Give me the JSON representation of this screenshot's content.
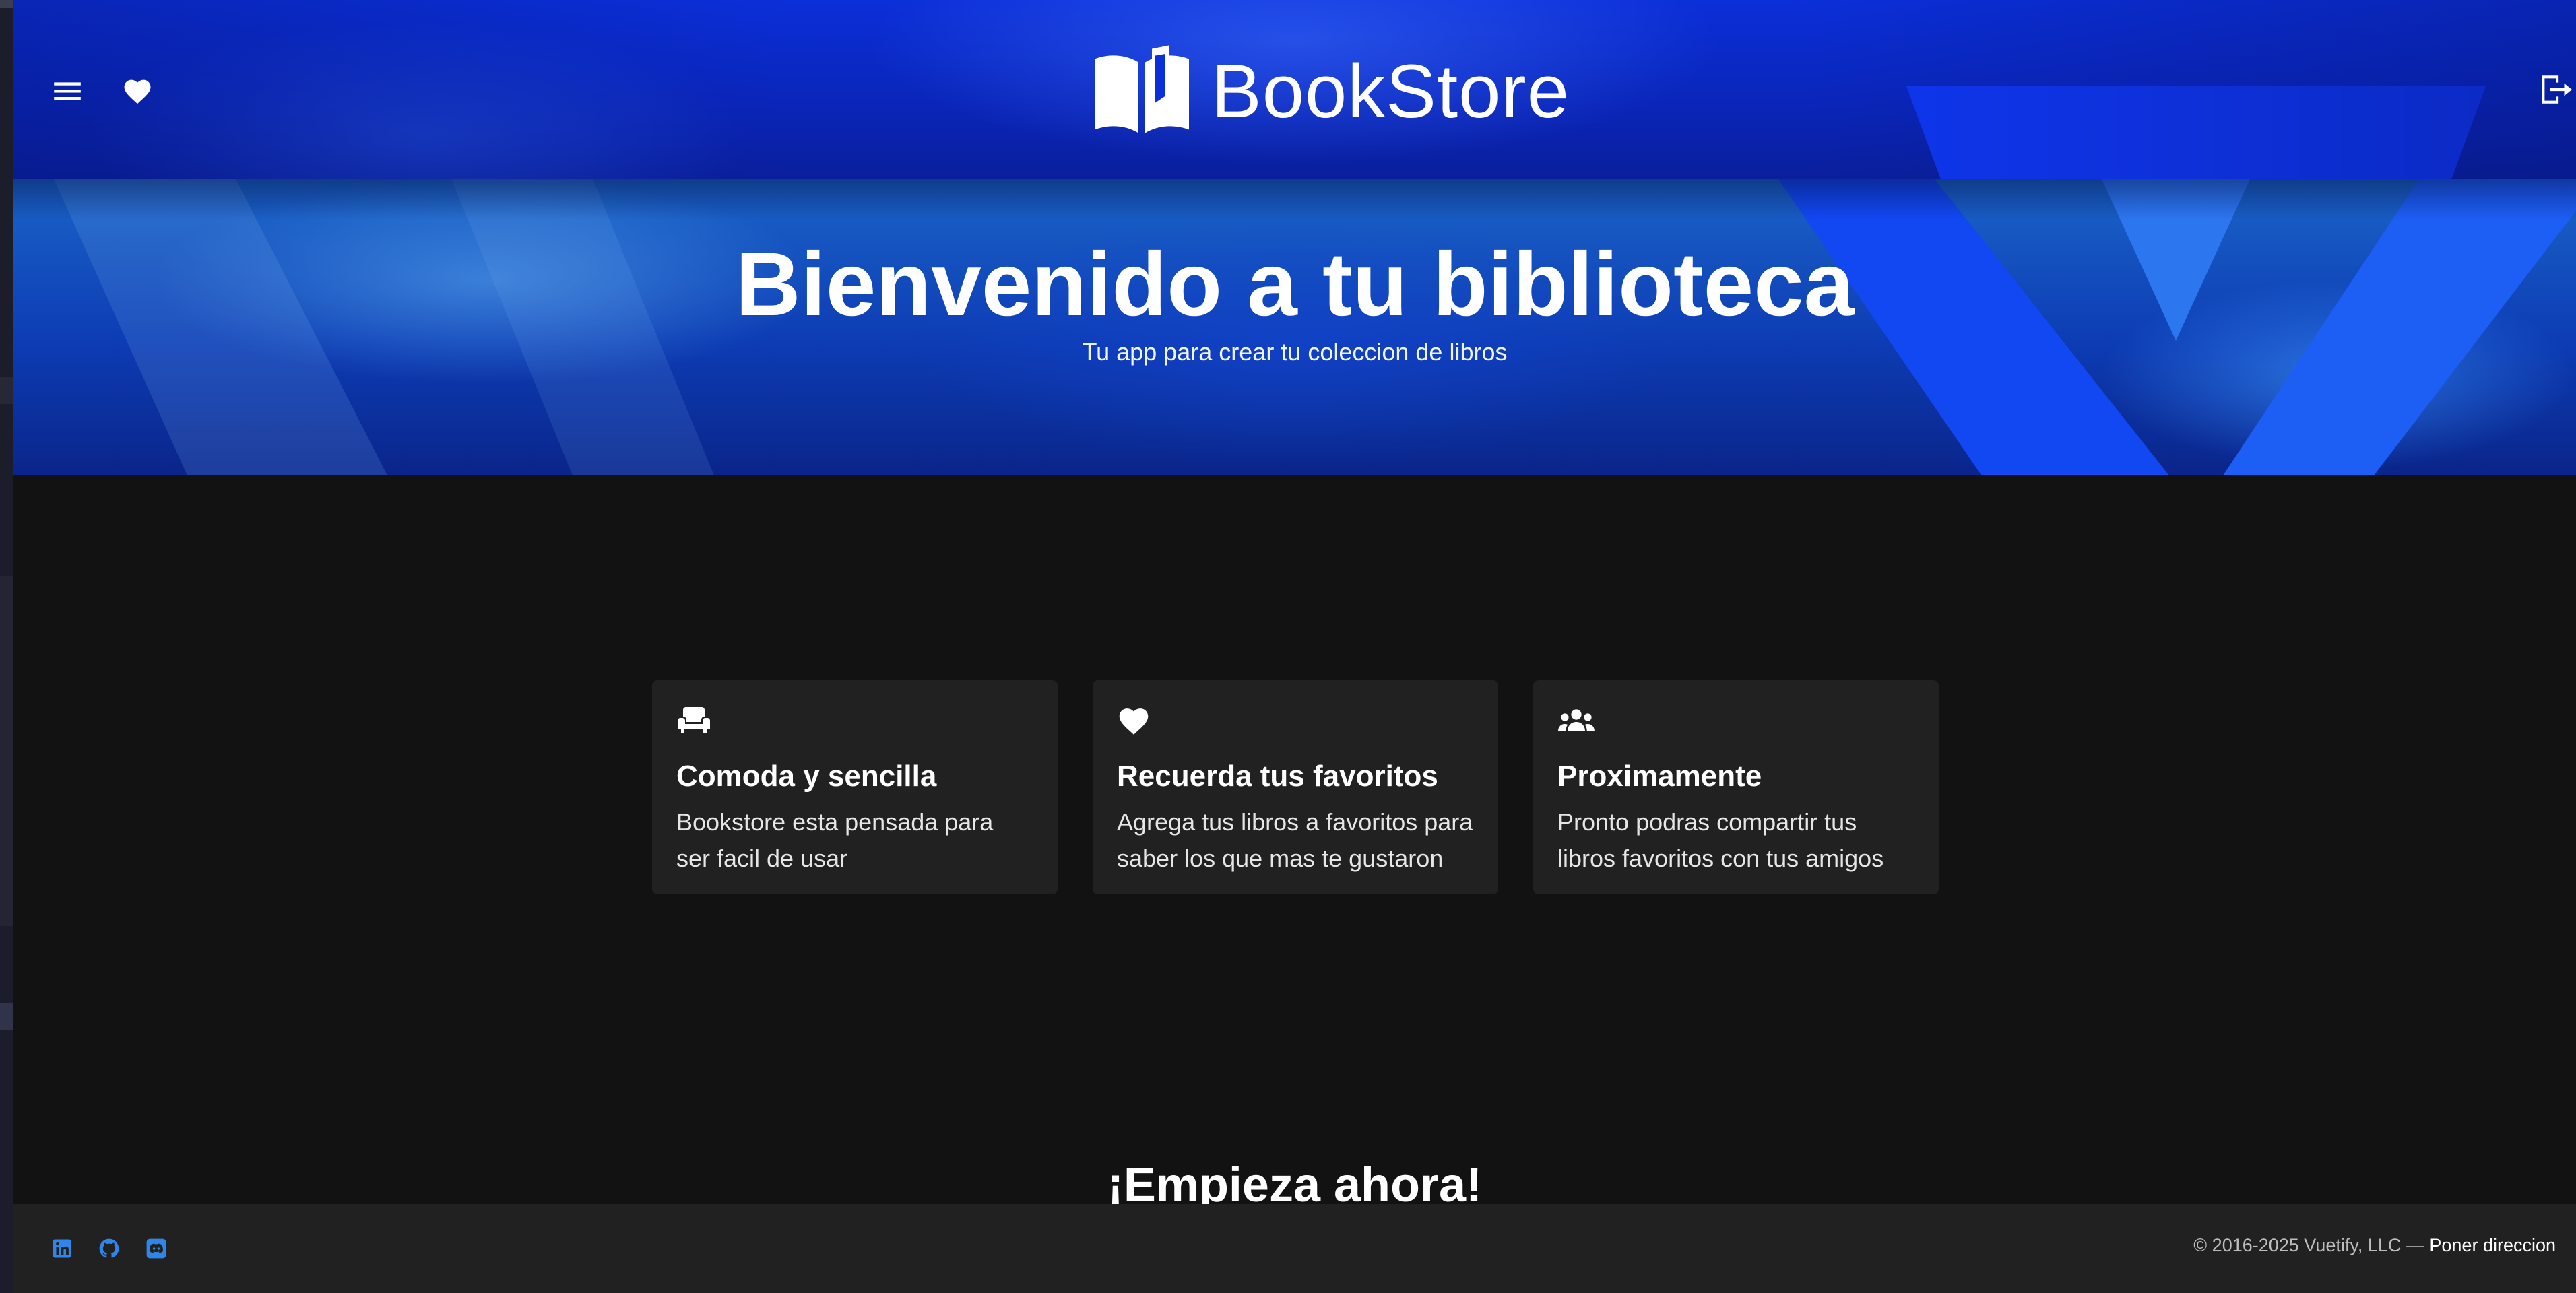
{
  "colors": {
    "appbar_blue": "#0b2fd8",
    "background": "#121212",
    "card_background": "#212121",
    "footer_background": "#212121",
    "social_icon": "#2f86e8"
  },
  "appbar": {
    "menu_icon": "menu-icon",
    "favorites_icon": "heart-icon",
    "logout_icon": "logout-icon",
    "logo_icon": "open-book-icon",
    "title": "BookStore"
  },
  "hero": {
    "title": "Bienvenido a tu biblioteca",
    "subtitle": "Tu app para crear tu coleccion de libros"
  },
  "features": [
    {
      "icon": "sofa-icon",
      "title": "Comoda y sencilla",
      "text": "Bookstore esta pensada para ser facil de usar"
    },
    {
      "icon": "heart-icon",
      "title": "Recuerda tus favoritos",
      "text": "Agrega tus libros a favoritos para saber los que mas te gustaron"
    },
    {
      "icon": "group-icon",
      "title": "Proximamente",
      "text": "Pronto podras compartir tus libros favoritos con tus amigos"
    }
  ],
  "cta": {
    "title": "¡Empieza ahora!"
  },
  "footer": {
    "social": [
      "linkedin-icon",
      "github-icon",
      "discord-icon"
    ],
    "copyright": "© 2016-2025 Vuetify, LLC —",
    "link": "Poner direccion"
  }
}
